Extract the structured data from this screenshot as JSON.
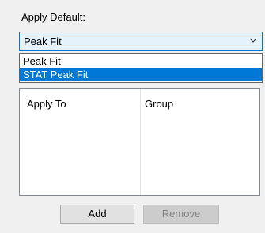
{
  "apply_default": {
    "label": "Apply Default:",
    "selected": "Peak Fit",
    "options": [
      "Peak Fit",
      "STAT Peak Fit"
    ],
    "highlighted_index": 1
  },
  "table": {
    "columns": [
      "Apply To",
      "Group"
    ],
    "rows": []
  },
  "buttons": {
    "add": "Add",
    "remove": "Remove"
  },
  "colors": {
    "accent": "#0078d7",
    "disabled_text": "#838383"
  },
  "icons": {
    "combo_arrow": "chevron-down-icon"
  }
}
